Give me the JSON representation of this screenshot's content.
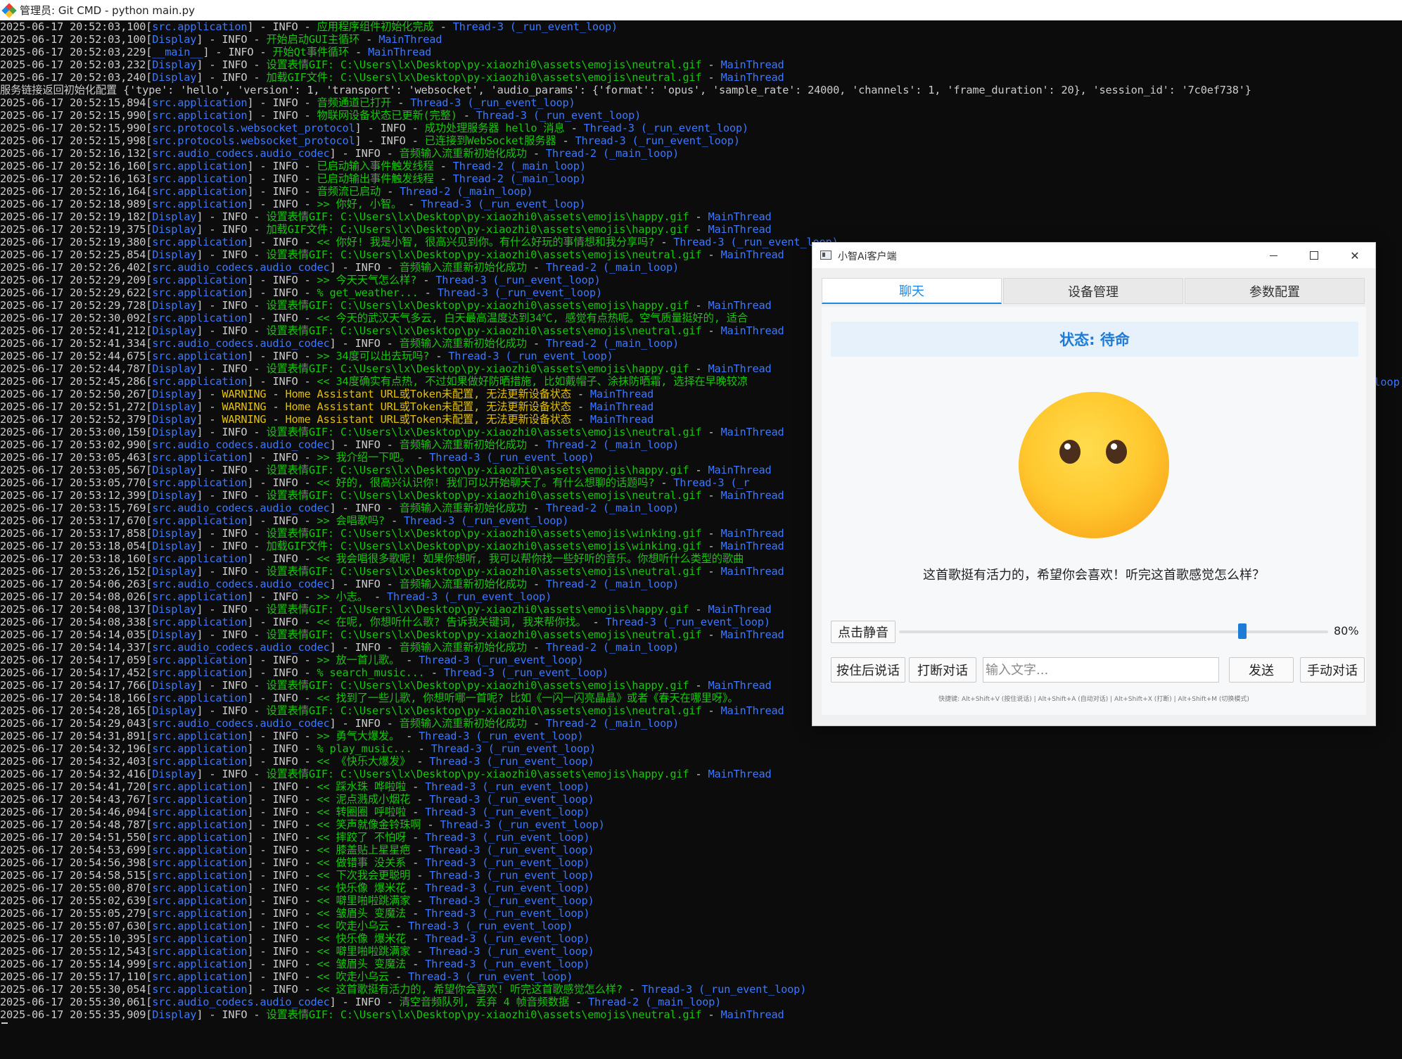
{
  "terminal": {
    "title": "管理员: Git CMD - python main.py",
    "lines": [
      {
        "ts": "2025-06-17 20:52:03,100",
        "mod": "src.application",
        "lvl": "INFO",
        "msg": "应用程序组件初始化完成",
        "thr": "Thread-3 (_run_event_loop)"
      },
      {
        "ts": "2025-06-17 20:52:03,100",
        "mod": "Display",
        "lvl": "INFO",
        "msg": "开始启动GUI主循环",
        "thr": "MainThread"
      },
      {
        "ts": "2025-06-17 20:52:03,229",
        "mod": "__main__",
        "lvl": "INFO",
        "msg": "开始Qt事件循环",
        "thr": "MainThread"
      },
      {
        "ts": "2025-06-17 20:52:03,232",
        "mod": "Display",
        "lvl": "INFO",
        "msg": "设置表情GIF: C:\\Users\\lx\\Desktop\\py-xiaozhi0\\assets\\emojis\\neutral.gif",
        "thr": "MainThread"
      },
      {
        "ts": "2025-06-17 20:52:03,240",
        "mod": "Display",
        "lvl": "INFO",
        "msg": "加载GIF文件: C:\\Users\\lx\\Desktop\\py-xiaozhi0\\assets\\emojis\\neutral.gif",
        "thr": "MainThread"
      },
      {
        "raw": "服务链接返回初始化配置 {'type': 'hello', 'version': 1, 'transport': 'websocket', 'audio_params': {'format': 'opus', 'sample_rate': 24000, 'channels': 1, 'frame_duration': 20}, 'session_id': '7c0ef738'}"
      },
      {
        "ts": "2025-06-17 20:52:15,894",
        "mod": "src.application",
        "lvl": "INFO",
        "msg": "音频通道已打开",
        "thr": "Thread-3 (_run_event_loop)"
      },
      {
        "ts": "2025-06-17 20:52:15,990",
        "mod": "src.application",
        "lvl": "INFO",
        "msg": "物联网设备状态已更新(完整)",
        "thr": "Thread-3 (_run_event_loop)"
      },
      {
        "ts": "2025-06-17 20:52:15,990",
        "mod": "src.protocols.websocket_protocol",
        "lvl": "INFO",
        "msg": "成功处理服务器 hello 消息",
        "thr": "Thread-3 (_run_event_loop)"
      },
      {
        "ts": "2025-06-17 20:52:15,998",
        "mod": "src.protocols.websocket_protocol",
        "lvl": "INFO",
        "msg": "已连接到WebSocket服务器",
        "thr": "Thread-3 (_run_event_loop)"
      },
      {
        "ts": "2025-06-17 20:52:16,132",
        "mod": "src.audio_codecs.audio_codec",
        "lvl": "INFO",
        "msg": "音频输入流重新初始化成功",
        "thr": "Thread-2 (_main_loop)"
      },
      {
        "ts": "2025-06-17 20:52:16,160",
        "mod": "src.application",
        "lvl": "INFO",
        "msg": "已启动输入事件触发线程",
        "thr": "Thread-2 (_main_loop)"
      },
      {
        "ts": "2025-06-17 20:52:16,163",
        "mod": "src.application",
        "lvl": "INFO",
        "msg": "已启动输出事件触发线程",
        "thr": "Thread-2 (_main_loop)"
      },
      {
        "ts": "2025-06-17 20:52:16,164",
        "mod": "src.application",
        "lvl": "INFO",
        "msg": "音频流已启动",
        "thr": "Thread-2 (_main_loop)"
      },
      {
        "ts": "2025-06-17 20:52:18,989",
        "mod": "src.application",
        "lvl": "INFO",
        "msg": ">> 你好, 小智。",
        "thr": "Thread-3 (_run_event_loop)"
      },
      {
        "ts": "2025-06-17 20:52:19,182",
        "mod": "Display",
        "lvl": "INFO",
        "msg": "设置表情GIF: C:\\Users\\lx\\Desktop\\py-xiaozhi0\\assets\\emojis\\happy.gif",
        "thr": "MainThread"
      },
      {
        "ts": "2025-06-17 20:52:19,375",
        "mod": "Display",
        "lvl": "INFO",
        "msg": "加载GIF文件: C:\\Users\\lx\\Desktop\\py-xiaozhi0\\assets\\emojis\\happy.gif",
        "thr": "MainThread"
      },
      {
        "ts": "2025-06-17 20:52:19,380",
        "mod": "src.application",
        "lvl": "INFO",
        "msg": "<< 你好! 我是小智, 很高兴见到你。有什么好玩的事情想和我分享吗?",
        "thr": "Thread-3 (_run_event_loop)"
      },
      {
        "ts": "2025-06-17 20:52:25,854",
        "mod": "Display",
        "lvl": "INFO",
        "msg": "设置表情GIF: C:\\Users\\lx\\Desktop\\py-xiaozhi0\\assets\\emojis\\neutral.gif",
        "thr": "MainThread"
      },
      {
        "ts": "2025-06-17 20:52:26,402",
        "mod": "src.audio_codecs.audio_codec",
        "lvl": "INFO",
        "msg": "音频输入流重新初始化成功",
        "thr": "Thread-2 (_main_loop)"
      },
      {
        "ts": "2025-06-17 20:52:29,209",
        "mod": "src.application",
        "lvl": "INFO",
        "msg": ">> 今天天气怎么样?",
        "thr": "Thread-3 (_run_event_loop)"
      },
      {
        "ts": "2025-06-17 20:52:29,622",
        "mod": "src.application",
        "lvl": "INFO",
        "msg": "% get_weather...",
        "thr": "Thread-3 (_run_event_loop)"
      },
      {
        "ts": "2025-06-17 20:52:29,728",
        "mod": "Display",
        "lvl": "INFO",
        "msg": "设置表情GIF: C:\\Users\\lx\\Desktop\\py-xiaozhi0\\assets\\emojis\\happy.gif",
        "thr": "MainThread"
      },
      {
        "ts": "2025-06-17 20:52:30,092",
        "mod": "src.application",
        "lvl": "INFO",
        "msg": "<< 今天的武汉天气多云, 白天最高温度达到34℃, 感觉有点热呢。空气质量挺好的, 适合",
        "thr": ""
      },
      {
        "ts": "2025-06-17 20:52:41,212",
        "mod": "Display",
        "lvl": "INFO",
        "msg": "设置表情GIF: C:\\Users\\lx\\Desktop\\py-xiaozhi0\\assets\\emojis\\neutral.gif",
        "thr": "MainThread"
      },
      {
        "ts": "2025-06-17 20:52:41,334",
        "mod": "src.audio_codecs.audio_codec",
        "lvl": "INFO",
        "msg": "音频输入流重新初始化成功",
        "thr": "Thread-2 (_main_loop)"
      },
      {
        "ts": "2025-06-17 20:52:44,675",
        "mod": "src.application",
        "lvl": "INFO",
        "msg": ">> 34度可以出去玩吗?",
        "thr": "Thread-3 (_run_event_loop)"
      },
      {
        "ts": "2025-06-17 20:52:44,787",
        "mod": "Display",
        "lvl": "INFO",
        "msg": "设置表情GIF: C:\\Users\\lx\\Desktop\\py-xiaozhi0\\assets\\emojis\\happy.gif",
        "thr": "MainThread"
      },
      {
        "ts": "2025-06-17 20:52:45,286",
        "mod": "src.application",
        "lvl": "INFO",
        "msg": "<< 34度确实有点热, 不过如果做好防晒措施, 比如戴帽子、涂抹防晒霜, 选择在早晚较凉",
        "thr": ""
      },
      {
        "ts": "2025-06-17 20:52:50,267",
        "mod": "Display",
        "lvl": "WARNING",
        "msg": "Home Assistant URL或Token未配置, 无法更新设备状态",
        "thr": "MainThread"
      },
      {
        "ts": "2025-06-17 20:52:51,272",
        "mod": "Display",
        "lvl": "WARNING",
        "msg": "Home Assistant URL或Token未配置, 无法更新设备状态",
        "thr": "MainThread"
      },
      {
        "ts": "2025-06-17 20:52:52,379",
        "mod": "Display",
        "lvl": "WARNING",
        "msg": "Home Assistant URL或Token未配置, 无法更新设备状态",
        "thr": "MainThread"
      },
      {
        "ts": "2025-06-17 20:53:00,159",
        "mod": "Display",
        "lvl": "INFO",
        "msg": "设置表情GIF: C:\\Users\\lx\\Desktop\\py-xiaozhi0\\assets\\emojis\\neutral.gif",
        "thr": "MainThread"
      },
      {
        "ts": "2025-06-17 20:53:02,990",
        "mod": "src.audio_codecs.audio_codec",
        "lvl": "INFO",
        "msg": "音频输入流重新初始化成功",
        "thr": "Thread-2 (_main_loop)"
      },
      {
        "ts": "2025-06-17 20:53:05,463",
        "mod": "src.application",
        "lvl": "INFO",
        "msg": ">> 我介绍一下吧。",
        "thr": "Thread-3 (_run_event_loop)"
      },
      {
        "ts": "2025-06-17 20:53:05,567",
        "mod": "Display",
        "lvl": "INFO",
        "msg": "设置表情GIF: C:\\Users\\lx\\Desktop\\py-xiaozhi0\\assets\\emojis\\happy.gif",
        "thr": "MainThread"
      },
      {
        "ts": "2025-06-17 20:53:05,770",
        "mod": "src.application",
        "lvl": "INFO",
        "msg": "<< 好的, 很高兴认识你! 我们可以开始聊天了。有什么想聊的话题吗?",
        "thr": "Thread-3 (_r"
      },
      {
        "ts": "2025-06-17 20:53:12,399",
        "mod": "Display",
        "lvl": "INFO",
        "msg": "设置表情GIF: C:\\Users\\lx\\Desktop\\py-xiaozhi0\\assets\\emojis\\neutral.gif",
        "thr": "MainThread"
      },
      {
        "ts": "2025-06-17 20:53:15,769",
        "mod": "src.audio_codecs.audio_codec",
        "lvl": "INFO",
        "msg": "音频输入流重新初始化成功",
        "thr": "Thread-2 (_main_loop)"
      },
      {
        "ts": "2025-06-17 20:53:17,670",
        "mod": "src.application",
        "lvl": "INFO",
        "msg": ">> 会唱歌吗?",
        "thr": "Thread-3 (_run_event_loop)"
      },
      {
        "ts": "2025-06-17 20:53:17,858",
        "mod": "Display",
        "lvl": "INFO",
        "msg": "设置表情GIF: C:\\Users\\lx\\Desktop\\py-xiaozhi0\\assets\\emojis\\winking.gif",
        "thr": "MainThread"
      },
      {
        "ts": "2025-06-17 20:53:18,054",
        "mod": "Display",
        "lvl": "INFO",
        "msg": "加载GIF文件: C:\\Users\\lx\\Desktop\\py-xiaozhi0\\assets\\emojis\\winking.gif",
        "thr": "MainThread"
      },
      {
        "ts": "2025-06-17 20:53:18,160",
        "mod": "src.application",
        "lvl": "INFO",
        "msg": "<< 我会唱很多歌呢! 如果你想听, 我可以帮你找一些好听的音乐。你想听什么类型的歌曲",
        "thr": ""
      },
      {
        "ts": "2025-06-17 20:53:26,152",
        "mod": "Display",
        "lvl": "INFO",
        "msg": "设置表情GIF: C:\\Users\\lx\\Desktop\\py-xiaozhi0\\assets\\emojis\\neutral.gif",
        "thr": "MainThread"
      },
      {
        "ts": "2025-06-17 20:54:06,263",
        "mod": "src.audio_codecs.audio_codec",
        "lvl": "INFO",
        "msg": "音频输入流重新初始化成功",
        "thr": "Thread-2 (_main_loop)"
      },
      {
        "ts": "2025-06-17 20:54:08,026",
        "mod": "src.application",
        "lvl": "INFO",
        "msg": ">> 小志。",
        "thr": "Thread-3 (_run_event_loop)"
      },
      {
        "ts": "2025-06-17 20:54:08,137",
        "mod": "Display",
        "lvl": "INFO",
        "msg": "设置表情GIF: C:\\Users\\lx\\Desktop\\py-xiaozhi0\\assets\\emojis\\happy.gif",
        "thr": "MainThread"
      },
      {
        "ts": "2025-06-17 20:54:08,338",
        "mod": "src.application",
        "lvl": "INFO",
        "msg": "<< 在呢, 你想听什么歌? 告诉我关键词, 我来帮你找。",
        "thr": "Thread-3 (_run_event_loop)"
      },
      {
        "ts": "2025-06-17 20:54:14,035",
        "mod": "Display",
        "lvl": "INFO",
        "msg": "设置表情GIF: C:\\Users\\lx\\Desktop\\py-xiaozhi0\\assets\\emojis\\neutral.gif",
        "thr": "MainThread"
      },
      {
        "ts": "2025-06-17 20:54:14,337",
        "mod": "src.audio_codecs.audio_codec",
        "lvl": "INFO",
        "msg": "音频输入流重新初始化成功",
        "thr": "Thread-2 (_main_loop)"
      },
      {
        "ts": "2025-06-17 20:54:17,059",
        "mod": "src.application",
        "lvl": "INFO",
        "msg": ">> 放一首儿歌。",
        "thr": "Thread-3 (_run_event_loop)"
      },
      {
        "ts": "2025-06-17 20:54:17,452",
        "mod": "src.application",
        "lvl": "INFO",
        "msg": "% search_music...",
        "thr": "Thread-3 (_run_event_loop)"
      },
      {
        "ts": "2025-06-17 20:54:17,766",
        "mod": "Display",
        "lvl": "INFO",
        "msg": "设置表情GIF: C:\\Users\\lx\\Desktop\\py-xiaozhi0\\assets\\emojis\\happy.gif",
        "thr": "MainThread"
      },
      {
        "ts": "2025-06-17 20:54:18,166",
        "mod": "src.application",
        "lvl": "INFO",
        "msg": "<< 找到了一些儿歌, 你想听哪一首呢? 比如《一闪一闪亮晶晶》或者《春天在哪里呀》。",
        "thr": ""
      },
      {
        "ts": "2025-06-17 20:54:28,165",
        "mod": "Display",
        "lvl": "INFO",
        "msg": "设置表情GIF: C:\\Users\\lx\\Desktop\\py-xiaozhi0\\assets\\emojis\\neutral.gif",
        "thr": "MainThread"
      },
      {
        "ts": "2025-06-17 20:54:29,043",
        "mod": "src.audio_codecs.audio_codec",
        "lvl": "INFO",
        "msg": "音频输入流重新初始化成功",
        "thr": "Thread-2 (_main_loop)"
      },
      {
        "ts": "2025-06-17 20:54:31,891",
        "mod": "src.application",
        "lvl": "INFO",
        "msg": ">> 勇气大爆发。",
        "thr": "Thread-3 (_run_event_loop)"
      },
      {
        "ts": "2025-06-17 20:54:32,196",
        "mod": "src.application",
        "lvl": "INFO",
        "msg": "% play_music...",
        "thr": "Thread-3 (_run_event_loop)"
      },
      {
        "ts": "2025-06-17 20:54:32,403",
        "mod": "src.application",
        "lvl": "INFO",
        "msg": "<< 《快乐大爆发》",
        "thr": "Thread-3 (_run_event_loop)"
      },
      {
        "ts": "2025-06-17 20:54:32,416",
        "mod": "Display",
        "lvl": "INFO",
        "msg": "设置表情GIF: C:\\Users\\lx\\Desktop\\py-xiaozhi0\\assets\\emojis\\happy.gif",
        "thr": "MainThread"
      },
      {
        "ts": "2025-06-17 20:54:41,720",
        "mod": "src.application",
        "lvl": "INFO",
        "msg": "<< 踩水珠 哗啦啦",
        "thr": "Thread-3 (_run_event_loop)"
      },
      {
        "ts": "2025-06-17 20:54:43,767",
        "mod": "src.application",
        "lvl": "INFO",
        "msg": "<< 泥点溅成小烟花",
        "thr": "Thread-3 (_run_event_loop)"
      },
      {
        "ts": "2025-06-17 20:54:46,094",
        "mod": "src.application",
        "lvl": "INFO",
        "msg": "<< 转圈圈 呼啦啦",
        "thr": "Thread-3 (_run_event_loop)"
      },
      {
        "ts": "2025-06-17 20:54:48,787",
        "mod": "src.application",
        "lvl": "INFO",
        "msg": "<< 笑声就像金铃珠啊",
        "thr": "Thread-3 (_run_event_loop)"
      },
      {
        "ts": "2025-06-17 20:54:51,550",
        "mod": "src.application",
        "lvl": "INFO",
        "msg": "<< 摔跤了 不怕呀",
        "thr": "Thread-3 (_run_event_loop)"
      },
      {
        "ts": "2025-06-17 20:54:53,699",
        "mod": "src.application",
        "lvl": "INFO",
        "msg": "<< 膝盖贴上星星疤",
        "thr": "Thread-3 (_run_event_loop)"
      },
      {
        "ts": "2025-06-17 20:54:56,398",
        "mod": "src.application",
        "lvl": "INFO",
        "msg": "<< 做错事 没关系",
        "thr": "Thread-3 (_run_event_loop)"
      },
      {
        "ts": "2025-06-17 20:54:58,515",
        "mod": "src.application",
        "lvl": "INFO",
        "msg": "<< 下次我会更聪明",
        "thr": "Thread-3 (_run_event_loop)"
      },
      {
        "ts": "2025-06-17 20:55:00,870",
        "mod": "src.application",
        "lvl": "INFO",
        "msg": "<< 快乐像 爆米花",
        "thr": "Thread-3 (_run_event_loop)"
      },
      {
        "ts": "2025-06-17 20:55:02,639",
        "mod": "src.application",
        "lvl": "INFO",
        "msg": "<< 噼里啪啦跳满家",
        "thr": "Thread-3 (_run_event_loop)"
      },
      {
        "ts": "2025-06-17 20:55:05,279",
        "mod": "src.application",
        "lvl": "INFO",
        "msg": "<< 皱眉头 变魔法",
        "thr": "Thread-3 (_run_event_loop)"
      },
      {
        "ts": "2025-06-17 20:55:07,630",
        "mod": "src.application",
        "lvl": "INFO",
        "msg": "<< 吹走小乌云",
        "thr": "Thread-3 (_run_event_loop)"
      },
      {
        "ts": "2025-06-17 20:55:10,395",
        "mod": "src.application",
        "lvl": "INFO",
        "msg": "<< 快乐像 爆米花",
        "thr": "Thread-3 (_run_event_loop)"
      },
      {
        "ts": "2025-06-17 20:55:12,543",
        "mod": "src.application",
        "lvl": "INFO",
        "msg": "<< 噼里啪啦跳满家",
        "thr": "Thread-3 (_run_event_loop)"
      },
      {
        "ts": "2025-06-17 20:55:14,999",
        "mod": "src.application",
        "lvl": "INFO",
        "msg": "<< 皱眉头 变魔法",
        "thr": "Thread-3 (_run_event_loop)"
      },
      {
        "ts": "2025-06-17 20:55:17,110",
        "mod": "src.application",
        "lvl": "INFO",
        "msg": "<< 吹走小乌云",
        "thr": "Thread-3 (_run_event_loop)"
      },
      {
        "ts": "2025-06-17 20:55:30,054",
        "mod": "src.application",
        "lvl": "INFO",
        "msg": "<< 这首歌挺有活力的, 希望你会喜欢! 听完这首歌感觉怎么样?",
        "thr": "Thread-3 (_run_event_loop)"
      },
      {
        "ts": "2025-06-17 20:55:30,061",
        "mod": "src.audio_codecs.audio_codec",
        "lvl": "INFO",
        "msg": "清空音频队列, 丢弃 4 帧音频数据",
        "thr": "Thread-2 (_main_loop)"
      },
      {
        "ts": "2025-06-17 20:55:35,909",
        "mod": "Display",
        "lvl": "INFO",
        "msg": "设置表情GIF: C:\\Users\\lx\\Desktop\\py-xiaozhi0\\assets\\emojis\\neutral.gif",
        "thr": "MainThread"
      }
    ],
    "overflow_right": "loop)"
  },
  "app": {
    "title": "小智Ai客户端",
    "tabs": [
      {
        "label": "聊天",
        "active": true
      },
      {
        "label": "设备管理",
        "active": false
      },
      {
        "label": "参数配置",
        "active": false
      }
    ],
    "status": "状态: 待命",
    "emoji_icon": "neutral-face-icon",
    "reply": "这首歌挺有活力的，希望你会喜欢！听完这首歌感觉怎么样？",
    "mute_button": "点击静音",
    "volume": 80,
    "volume_label": "80%",
    "hold_to_talk": "按住后说话",
    "interrupt": "打断对话",
    "input_placeholder": "输入文字...",
    "send": "发送",
    "manual": "手动对话",
    "hotkeys": "快捷键: Alt+Shift+V (按住说话) | Alt+Shift+A (自动对话) | Alt+Shift+X (打断) | Alt+Shift+M (切换模式)"
  },
  "colors": {
    "accent": "#1e7bd6",
    "terminal_bg": "#0c0c0c",
    "module_blue": "#3b78ff",
    "message_green": "#16c60c",
    "warning_yellow": "#e5c000"
  }
}
